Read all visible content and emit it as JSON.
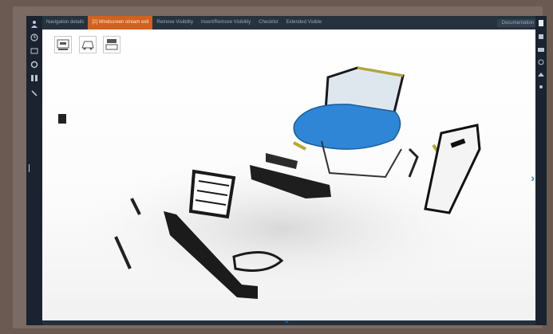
{
  "toolbar": {
    "tabs": [
      {
        "label": "Navigation details"
      },
      {
        "label": "[2] Windscreen stream exit",
        "active": true
      },
      {
        "label": "Remove Visibility"
      },
      {
        "label": "Insert/Remove Visibility"
      },
      {
        "label": "Checklist"
      },
      {
        "label": "Extended Visible"
      }
    ],
    "right_label": "Documentation"
  },
  "colors": {
    "accent": "#d0611f",
    "hood": "#2f86d6",
    "frame": "#6b5a52",
    "window_bg": "#1d2733"
  },
  "left_icons": [
    "person-icon",
    "history-icon",
    "image-icon",
    "gear-icon",
    "grid-icon",
    "wrench-icon"
  ],
  "right_icons": [
    "page-icon",
    "list-icon",
    "camera-icon",
    "settings-icon",
    "hat-icon",
    "person-icon"
  ],
  "view_buttons": [
    "view-front-icon",
    "view-side-icon",
    "view-top-icon"
  ]
}
